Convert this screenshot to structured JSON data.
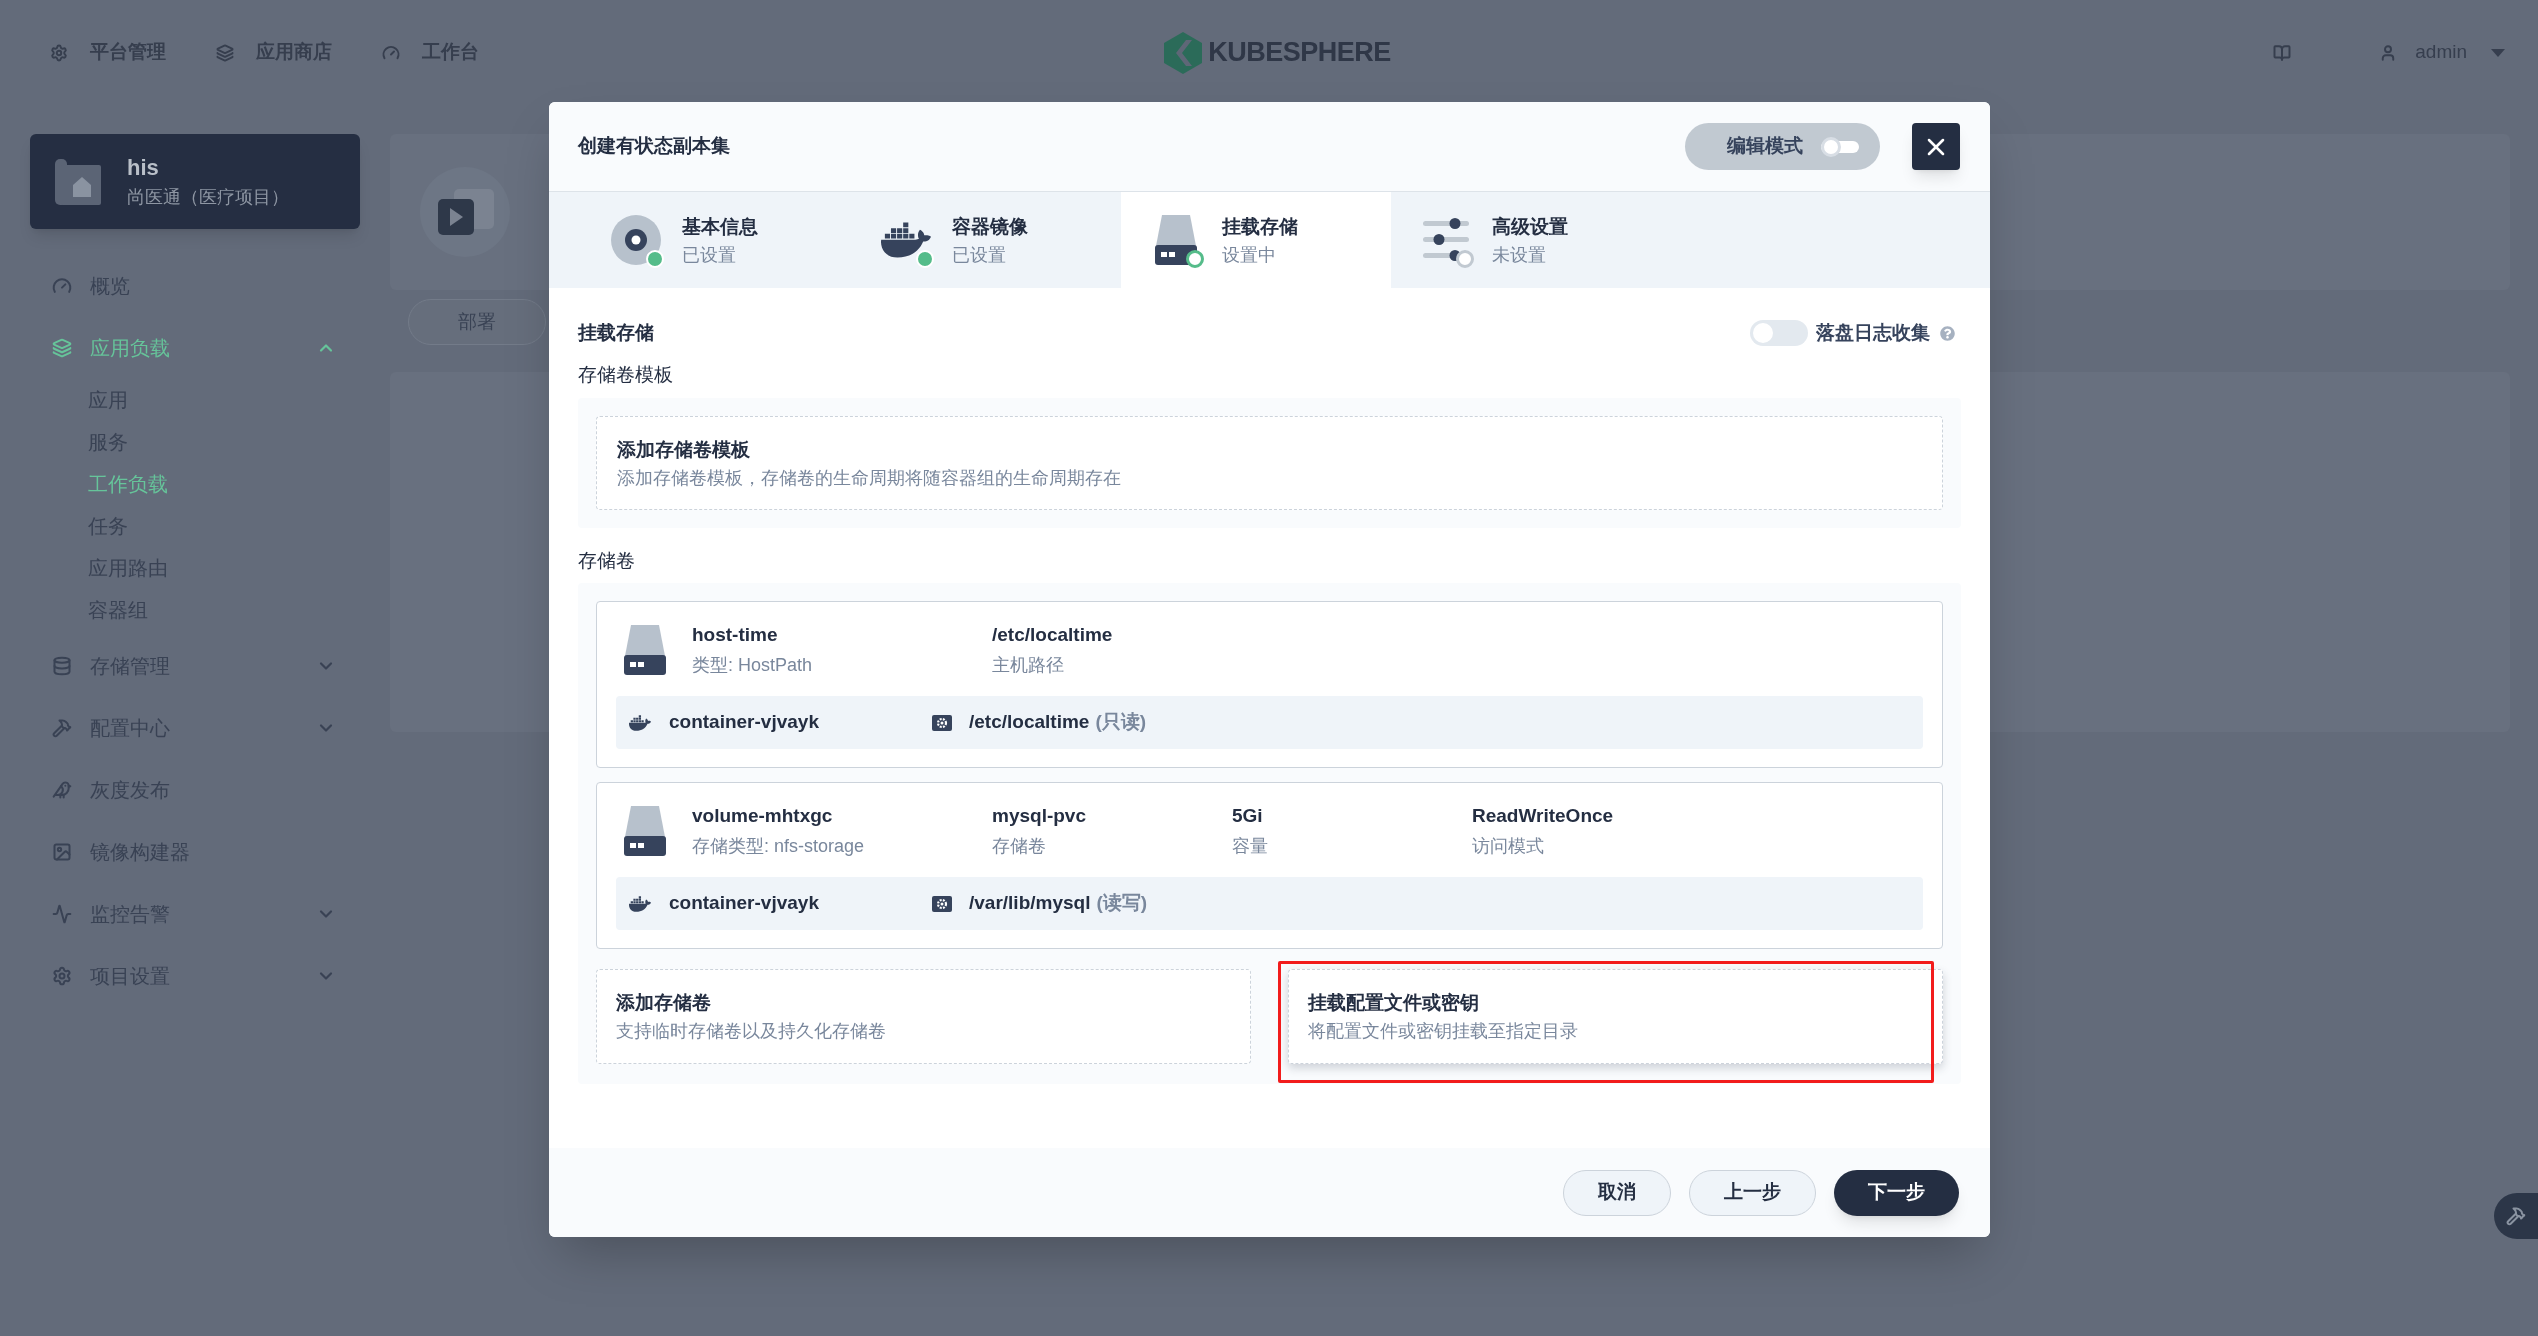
{
  "top_bar": {
    "nav": [
      {
        "label": "平台管理"
      },
      {
        "label": "应用商店"
      },
      {
        "label": "工作台"
      }
    ],
    "logo": "KUBESPHERE",
    "user": "admin"
  },
  "sidebar": {
    "project": {
      "name": "his",
      "description": "尚医通（医疗项目）"
    },
    "items": [
      {
        "label": "概览",
        "kind": "link",
        "selected": false
      },
      {
        "label": "应用负载",
        "kind": "group",
        "selected": true,
        "expanded": true,
        "children": [
          {
            "label": "应用",
            "selected": false
          },
          {
            "label": "服务",
            "selected": false
          },
          {
            "label": "工作负载",
            "selected": true
          },
          {
            "label": "任务",
            "selected": false
          },
          {
            "label": "应用路由",
            "selected": false
          },
          {
            "label": "容器组",
            "selected": false
          }
        ]
      },
      {
        "label": "存储管理",
        "kind": "group",
        "selected": false,
        "expanded": false
      },
      {
        "label": "配置中心",
        "kind": "group",
        "selected": false,
        "expanded": false
      },
      {
        "label": "灰度发布",
        "kind": "link",
        "selected": false
      },
      {
        "label": "镜像构建器",
        "kind": "link",
        "selected": false
      },
      {
        "label": "监控告警",
        "kind": "group",
        "selected": false,
        "expanded": false
      },
      {
        "label": "项目设置",
        "kind": "group",
        "selected": false,
        "expanded": false
      }
    ]
  },
  "background_page": {
    "tab": "部署"
  },
  "modal": {
    "title": "创建有状态副本集",
    "edit_mode": {
      "label": "编辑模式",
      "on": false
    },
    "steps": [
      {
        "title": "基本信息",
        "status": "已设置",
        "completed": true,
        "selected": false
      },
      {
        "title": "容器镜像",
        "status": "已设置",
        "completed": true,
        "selected": false
      },
      {
        "title": "挂载存储",
        "status": "设置中",
        "completed": false,
        "selected": true
      },
      {
        "title": "高级设置",
        "status": "未设置",
        "completed": false,
        "selected": false
      }
    ],
    "section_title": "挂载存储",
    "log_collection": {
      "label": "落盘日志收集",
      "on": false
    },
    "templates": {
      "label": "存储卷模板",
      "add": {
        "title": "添加存储卷模板",
        "description": "添加存储卷模板，存储卷的生命周期将随容器组的生命周期存在"
      }
    },
    "volumes": {
      "label": "存储卷",
      "items": [
        {
          "fields": [
            {
              "value": "host-time",
              "label": "类型: HostPath"
            },
            {
              "value": "/etc/localtime",
              "label": "主机路径"
            }
          ],
          "mounts": [
            {
              "container": "container-vjvayk",
              "path": "/etc/localtime",
              "mode": "(只读)"
            }
          ]
        },
        {
          "fields": [
            {
              "value": "volume-mhtxgc",
              "label": "存储类型: nfs-storage"
            },
            {
              "value": "mysql-pvc",
              "label": "存储卷"
            },
            {
              "value": "5Gi",
              "label": "容量"
            },
            {
              "value": "ReadWriteOnce",
              "label": "访问模式"
            }
          ],
          "mounts": [
            {
              "container": "container-vjvayk",
              "path": "/var/lib/mysql",
              "mode": "(读写)"
            }
          ]
        }
      ],
      "actions": [
        {
          "title": "添加存储卷",
          "description": "支持临时存储卷以及持久化存储卷",
          "highlighted": false
        },
        {
          "title": "挂载配置文件或密钥",
          "description": "将配置文件或密钥挂载至指定目录",
          "highlighted": true
        }
      ]
    },
    "buttons": [
      {
        "label": "取消",
        "kind": "secondary"
      },
      {
        "label": "上一步",
        "kind": "secondary"
      },
      {
        "label": "下一步",
        "kind": "primary"
      }
    ]
  }
}
